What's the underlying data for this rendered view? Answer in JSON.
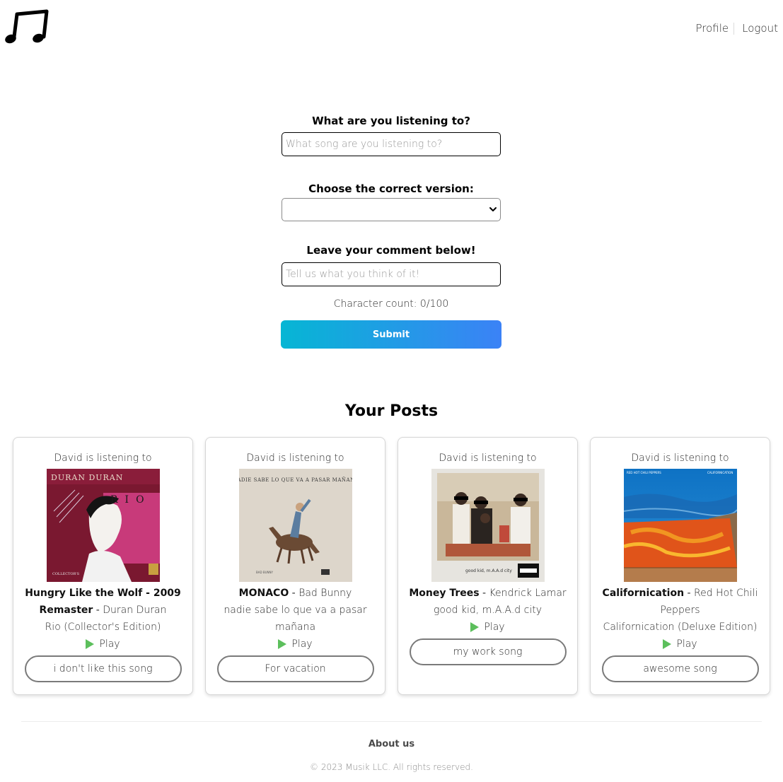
{
  "header": {
    "logo_icon": "music-notes-icon",
    "nav": {
      "profile_label": "Profile",
      "logout_label": "Logout"
    }
  },
  "form": {
    "song_label": "What are you listening to?",
    "song_placeholder": "What song are you listening to?",
    "song_value": "",
    "version_label": "Choose the correct version:",
    "version_value": "",
    "comment_label": "Leave your comment below!",
    "comment_placeholder": "Tell us what you think of it!",
    "comment_value": "",
    "char_count_text": "Character count: 0/100",
    "submit_label": "Submit",
    "submit_gradient": [
      "#06b6d4",
      "#3b82f6"
    ]
  },
  "posts": {
    "title": "Your Posts",
    "items": [
      {
        "user_text": "David is listening to",
        "song": "Hungry Like the Wolf - 2009 Remaster",
        "artist": "Duran Duran",
        "album": "Rio (Collector's Edition)",
        "play_label": "Play",
        "comment": "i don't like this song",
        "cover_icon": "album-cover-rio"
      },
      {
        "user_text": "David is listening to",
        "song": "MONACO",
        "artist": "Bad Bunny",
        "album": "nadie sabe lo que va a pasar mañana",
        "play_label": "Play",
        "comment": "For vacation",
        "cover_icon": "album-cover-nadie-sabe",
        "cover_text": "NADIE SABE LO QUE VA A PASAR MAÑANA"
      },
      {
        "user_text": "David is listening to",
        "song": "Money Trees",
        "artist": "Kendrick Lamar",
        "album": "good kid, m.A.A.d city",
        "play_label": "Play",
        "comment": "my work song",
        "cover_icon": "album-cover-good-kid-maad-city"
      },
      {
        "user_text": "David is listening to",
        "song": "Californication",
        "artist": "Red Hot Chili Peppers",
        "album": "Californication (Deluxe Edition)",
        "play_label": "Play",
        "comment": "awesome song",
        "cover_icon": "album-cover-californication"
      }
    ]
  },
  "footer": {
    "about_label": "About us",
    "copyright": "© 2023 Musik LLC. All rights reserved."
  },
  "colors": {
    "play_icon": "#5cbf5c",
    "pill_border": "#7a7a7a",
    "card_border": "#d6d6d6"
  }
}
